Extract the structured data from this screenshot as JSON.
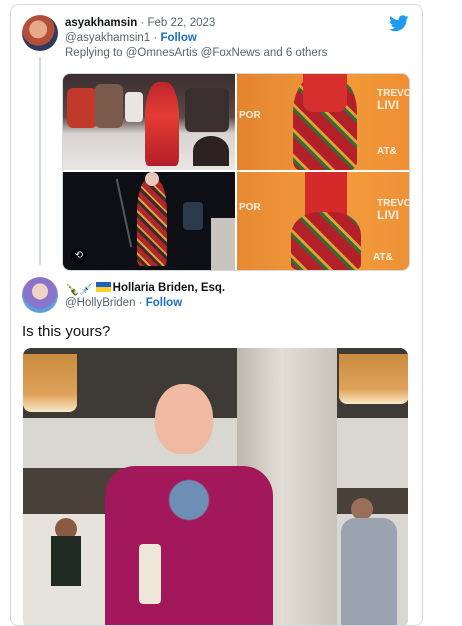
{
  "tweet1": {
    "display_name": "asyakhamsin",
    "separator": "·",
    "date": "Feb 22, 2023",
    "handle": "@asyakhamsin1",
    "follow_label": "Follow",
    "replying_to": "Replying to @OmnesArtis @FoxNews and 6 others",
    "media_overlay_top": "TREVC",
    "media_overlay_bottom": "TREVC",
    "media_overlay_live": "LIVI",
    "media_overlay_att_top": "AT&",
    "media_overlay_att_bottom": "AT&",
    "media_overlay_por_top": "POR",
    "media_overlay_por_bottom": "POR"
  },
  "tweet2": {
    "display_name": "Hollaria Briden, Esq.",
    "emoji_prefix": "🍾💉",
    "handle": "@HollyBriden",
    "separator": "·",
    "follow_label": "Follow",
    "text": "Is this yours?"
  },
  "icons": {
    "brand": "twitter-bird-icon",
    "gif": "play-gif-icon"
  },
  "colors": {
    "brand_blue": "#1d9bf0",
    "follow_blue": "#1d6fbf",
    "muted": "#536471",
    "border": "#cfd9de"
  }
}
